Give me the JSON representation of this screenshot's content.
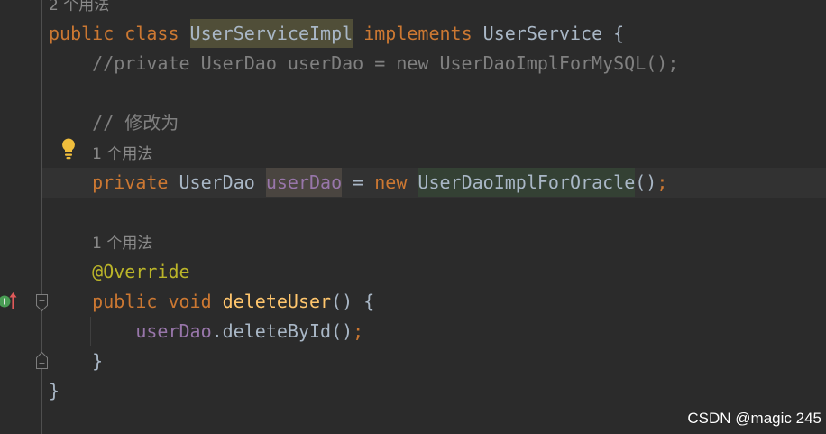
{
  "theme": {
    "editor_background": "#2B2B2B",
    "current_line_background": "#323232",
    "gutter_separator": "#4F4F4F",
    "indent_guide": "#3F3F3F"
  },
  "icons": {
    "intention_action": "lightbulb-icon",
    "implements_marker": "implements-method-icon",
    "fold_start": "fold-marker-icon",
    "fold_end": "fold-marker-icon"
  },
  "editor": {
    "lines": [
      {
        "tokens": [
          {
            "text": "2 个用法",
            "color": "#8A8A8A",
            "hint": true
          }
        ]
      },
      {
        "tokens": [
          {
            "text": "public class ",
            "color": "#CC7832"
          },
          {
            "text": "UserServiceImpl",
            "color": "#A9B7C6",
            "bg": "#504E38"
          },
          {
            "text": " implements ",
            "color": "#CC7832"
          },
          {
            "text": "UserService {",
            "color": "#A9B7C6"
          }
        ]
      },
      {
        "tokens": [
          {
            "text": "    //private UserDao userDao = new UserDaoImplForMySQL();",
            "color": "#808080"
          }
        ]
      },
      {
        "tokens": []
      },
      {
        "tokens": [
          {
            "text": "    // 修改为",
            "color": "#808080"
          }
        ]
      },
      {
        "tokens": [
          {
            "text": "    ",
            "color": "#A9B7C6"
          },
          {
            "text": "1 个用法",
            "color": "#8A8A8A",
            "hint": true
          }
        ]
      },
      {
        "current": true,
        "tokens": [
          {
            "text": "    private ",
            "color": "#CC7832"
          },
          {
            "text": "UserDao ",
            "color": "#A9B7C6"
          },
          {
            "text": "userDao",
            "color": "#9876AA",
            "bg": "#4A4540"
          },
          {
            "text": " = ",
            "color": "#A9B7C6"
          },
          {
            "text": "new ",
            "color": "#CC7832"
          },
          {
            "text": "UserDaoImplForOracle",
            "color": "#A9B7C6",
            "bg": "#344134"
          },
          {
            "text": "()",
            "color": "#A9B7C6"
          },
          {
            "text": ";",
            "color": "#CC7832"
          }
        ]
      },
      {
        "tokens": []
      },
      {
        "tokens": [
          {
            "text": "    ",
            "color": "#A9B7C6"
          },
          {
            "text": "1 个用法",
            "color": "#8A8A8A",
            "hint": true
          }
        ]
      },
      {
        "tokens": [
          {
            "text": "    @Override",
            "color": "#BBB529"
          }
        ]
      },
      {
        "tokens": [
          {
            "text": "    public void ",
            "color": "#CC7832"
          },
          {
            "text": "deleteUser",
            "color": "#FFC66D"
          },
          {
            "text": "() {",
            "color": "#A9B7C6"
          }
        ]
      },
      {
        "tokens": [
          {
            "text": "        userDao",
            "color": "#9876AA"
          },
          {
            "text": ".deleteById()",
            "color": "#A9B7C6"
          },
          {
            "text": ";",
            "color": "#CC7832"
          }
        ]
      },
      {
        "tokens": [
          {
            "text": "    }",
            "color": "#A9B7C6"
          }
        ]
      },
      {
        "tokens": [
          {
            "text": "}",
            "color": "#A9B7C6"
          }
        ]
      }
    ]
  },
  "watermark": {
    "text": "CSDN @magic 245"
  }
}
